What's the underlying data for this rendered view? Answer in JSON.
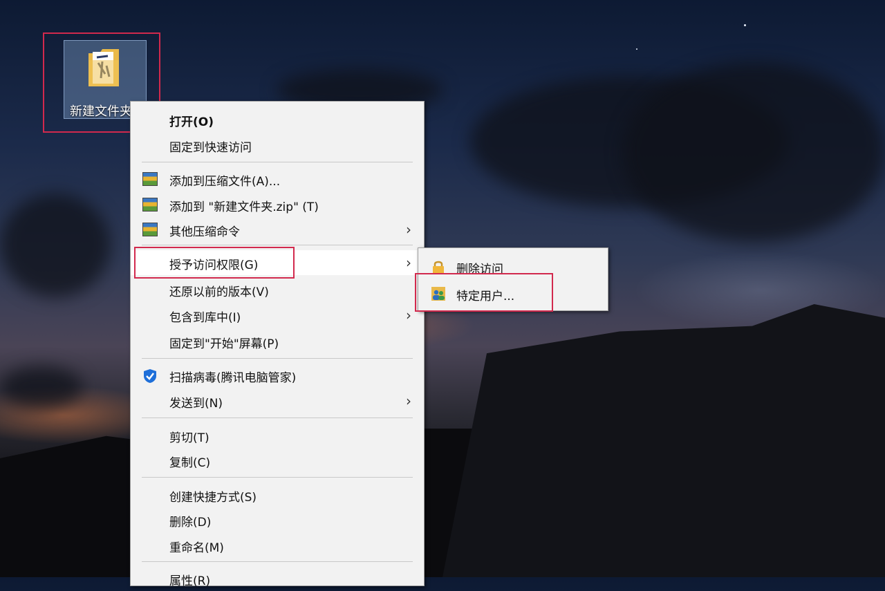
{
  "desktop": {
    "folder_label": "新建文件夹"
  },
  "context_menu": {
    "items": [
      {
        "label": "打开(O)"
      },
      {
        "label": "固定到快速访问"
      },
      {
        "label": "添加到压缩文件(A)..."
      },
      {
        "label": "添加到 \"新建文件夹.zip\" (T)"
      },
      {
        "label": "其他压缩命令"
      },
      {
        "label": "授予访问权限(G)"
      },
      {
        "label": "还原以前的版本(V)"
      },
      {
        "label": "包含到库中(I)"
      },
      {
        "label": "固定到\"开始\"屏幕(P)"
      },
      {
        "label": "扫描病毒(腾讯电脑管家)"
      },
      {
        "label": "发送到(N)"
      },
      {
        "label": "剪切(T)"
      },
      {
        "label": "复制(C)"
      },
      {
        "label": "创建快捷方式(S)"
      },
      {
        "label": "删除(D)"
      },
      {
        "label": "重命名(M)"
      },
      {
        "label": "属性(R)"
      }
    ],
    "submenu_arrow": "›"
  },
  "share_submenu": {
    "items": [
      {
        "label": "删除访问",
        "icon": "lock-icon"
      },
      {
        "label": "特定用户...",
        "icon": "users-icon"
      }
    ]
  },
  "highlight_color": "#d2294d"
}
